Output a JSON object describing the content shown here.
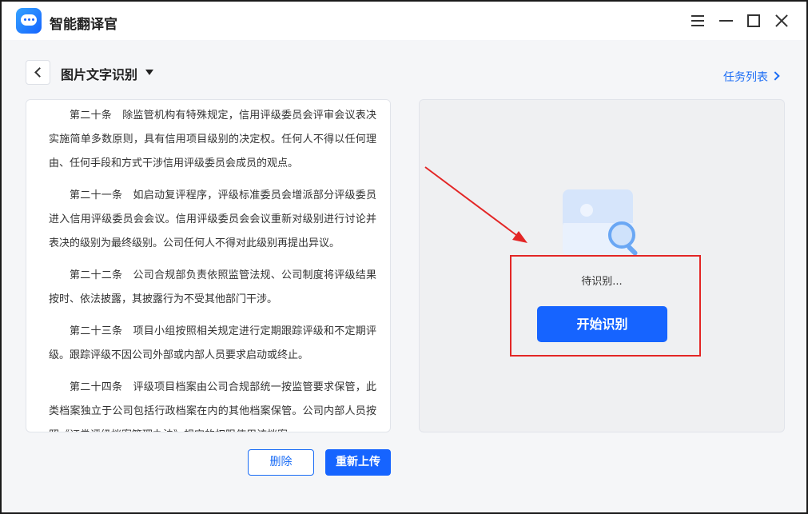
{
  "app": {
    "title": "智能翻译官"
  },
  "header": {
    "page_title": "图片文字识别",
    "task_list_label": "任务列表"
  },
  "document": {
    "paragraphs": [
      "第二十条　除监管机构有特殊规定，信用评级委员会评审会议表决实施简单多数原则，具有信用项目级别的决定权。任何人不得以任何理由、任何手段和方式干涉信用评级委员会成员的观点。",
      "第二十一条　如启动复评程序，评级标准委员会增派部分评级委员进入信用评级委员会会议。信用评级委员会会议重新对级别进行讨论并表决的级别为最终级别。公司任何人不得对此级别再提出异议。",
      "第二十二条　公司合规部负责依照监管法规、公司制度将评级结果按时、依法披露，其披露行为不受其他部门干涉。",
      "第二十三条　项目小组按照相关规定进行定期跟踪评级和不定期评级。跟踪评级不因公司外部或内部人员要求启动或终止。",
      "第二十四条　评级项目档案由公司合规部统一按监管要求保管，此类档案独立于公司包括行政档案在内的其他档案保管。公司内部人员按照《证券评级档案管理办法》规定的权限使用该档案。"
    ]
  },
  "result": {
    "status_text": "待识别...",
    "start_button_label": "开始识别"
  },
  "footer": {
    "delete_label": "删除",
    "reupload_label": "重新上传"
  },
  "colors": {
    "accent": "#1664ff",
    "annotation_red": "#e32626"
  },
  "icons": [
    "app-logo-icon",
    "menu-icon",
    "minimize-icon",
    "maximize-icon",
    "close-icon",
    "back-arrow-icon",
    "caret-down-icon",
    "chevron-right-icon",
    "image-placeholder-icon",
    "magnifier-icon"
  ]
}
